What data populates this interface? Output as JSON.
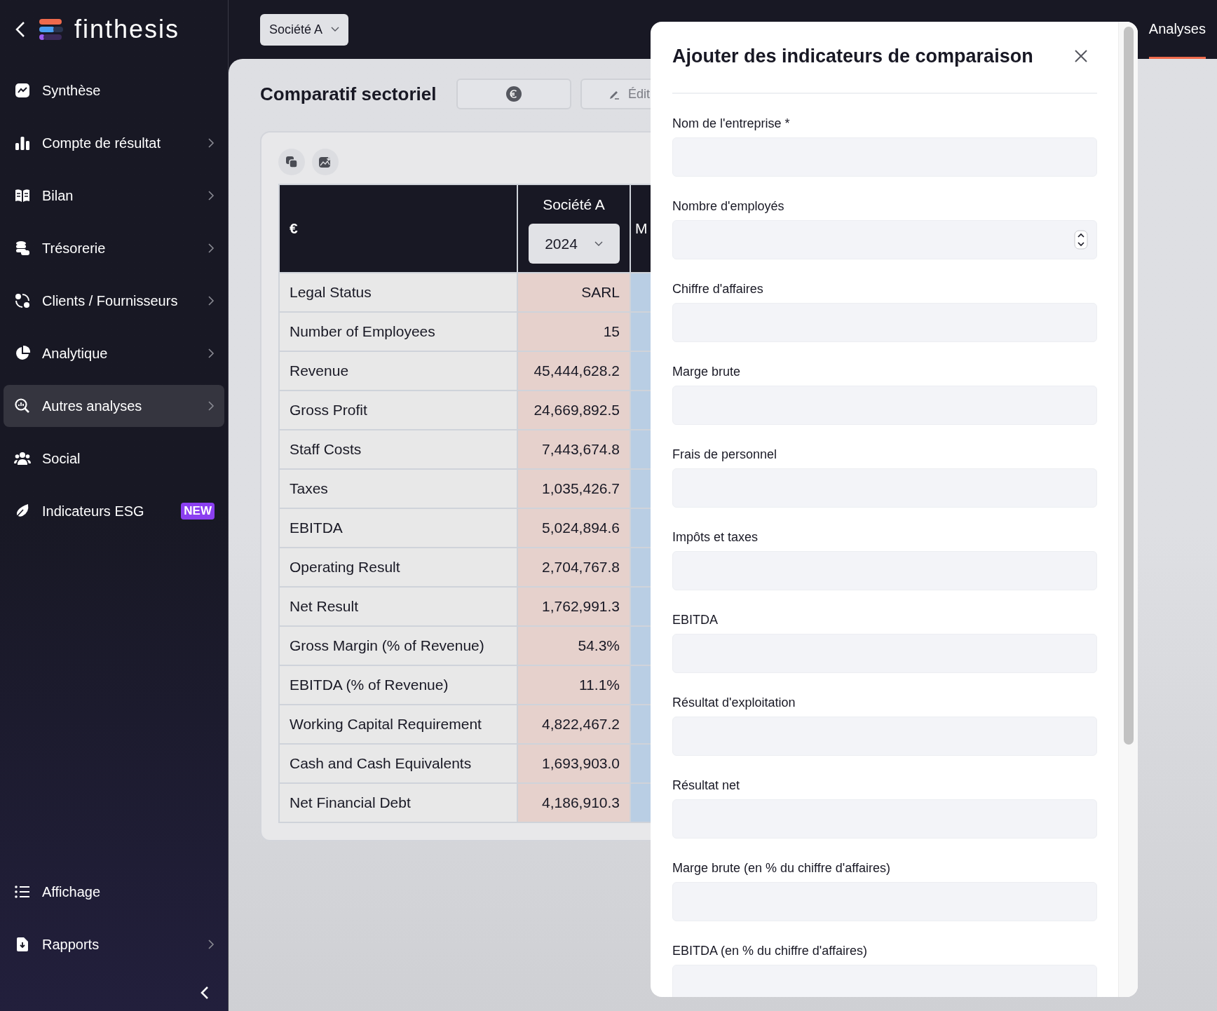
{
  "sidebar": {
    "logo": "finthesis",
    "items": [
      {
        "label": "Synthèse",
        "selected": false,
        "has_submenu": false
      },
      {
        "label": "Compte de résultat",
        "selected": false,
        "has_submenu": true
      },
      {
        "label": "Bilan",
        "selected": false,
        "has_submenu": true
      },
      {
        "label": "Trésorerie",
        "selected": false,
        "has_submenu": true
      },
      {
        "label": "Clients / Fournisseurs",
        "selected": false,
        "has_submenu": true
      },
      {
        "label": "Analytique",
        "selected": false,
        "has_submenu": true
      },
      {
        "label": "Autres analyses",
        "selected": true,
        "has_submenu": true
      },
      {
        "label": "Social",
        "selected": false,
        "has_submenu": false
      },
      {
        "label": "Indicateurs ESG",
        "selected": false,
        "has_submenu": false,
        "badge": "NEW"
      }
    ],
    "bottom_items": [
      {
        "label": "Affichage",
        "selected": false,
        "has_submenu": false
      },
      {
        "label": "Rapports",
        "selected": false,
        "has_submenu": true
      }
    ]
  },
  "topbar": {
    "company_select": "Société A",
    "tabs": [
      {
        "label": "Analyses",
        "selected": true
      }
    ]
  },
  "page": {
    "title": "Comparatif sectoriel",
    "edit_button": "Édit"
  },
  "table": {
    "corner": "€",
    "columns": [
      {
        "name": "Société A",
        "year": "2024"
      },
      {
        "name": "M"
      }
    ],
    "rows": [
      {
        "label": "Legal Status",
        "value": "SARL"
      },
      {
        "label": "Number of Employees",
        "value": "15"
      },
      {
        "label": "Revenue",
        "value": "45,444,628.2"
      },
      {
        "label": "Gross Profit",
        "value": "24,669,892.5"
      },
      {
        "label": "Staff Costs",
        "value": "7,443,674.8"
      },
      {
        "label": "Taxes",
        "value": "1,035,426.7"
      },
      {
        "label": "EBITDA",
        "value": "5,024,894.6"
      },
      {
        "label": "Operating Result",
        "value": "2,704,767.8"
      },
      {
        "label": "Net Result",
        "value": "1,762,991.3"
      },
      {
        "label": "Gross Margin (% of Revenue)",
        "value": "54.3%"
      },
      {
        "label": "EBITDA (% of Revenue)",
        "value": "11.1%"
      },
      {
        "label": "Working Capital Requirement",
        "value": "4,822,467.2"
      },
      {
        "label": "Cash and Cash Equivalents",
        "value": "1,693,903.0"
      },
      {
        "label": "Net Financial Debt",
        "value": "4,186,910.3"
      }
    ]
  },
  "modal": {
    "title": "Ajouter des indicateurs de comparaison",
    "fields": [
      {
        "label": "Nom de l'entreprise *",
        "kind": "text"
      },
      {
        "label": "Nombre d'employés",
        "kind": "number"
      },
      {
        "label": "Chiffre d'affaires",
        "kind": "text"
      },
      {
        "label": "Marge brute",
        "kind": "text"
      },
      {
        "label": "Frais de personnel",
        "kind": "text"
      },
      {
        "label": "Impôts et taxes",
        "kind": "text"
      },
      {
        "label": "EBITDA",
        "kind": "text"
      },
      {
        "label": "Résultat d'exploitation",
        "kind": "text"
      },
      {
        "label": "Résultat net",
        "kind": "text"
      },
      {
        "label": "Marge brute (en % du chiffre d'affaires)",
        "kind": "text"
      },
      {
        "label": "EBITDA (en % du chiffre d'affaires)",
        "kind": "text"
      }
    ]
  }
}
